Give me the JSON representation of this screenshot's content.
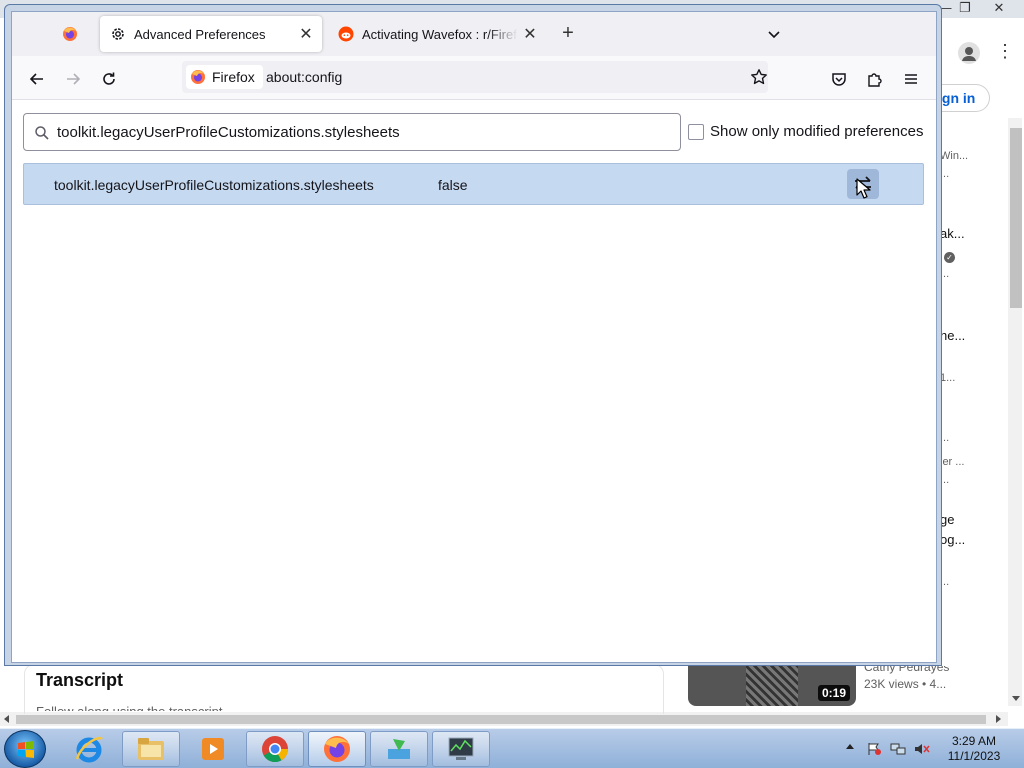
{
  "background_window": {
    "controls": [
      "—",
      "❐",
      "✕"
    ],
    "signin_label": "ign in",
    "fragments": [
      "Win...",
      "...",
      "ak...",
      "...",
      "he...",
      "1...",
      "...",
      "ler ...",
      "...",
      "ge",
      "og...",
      "..."
    ],
    "transcript_title": "Transcript",
    "transcript_sub": "Follow along using the transcript.",
    "video_duration": "0:19",
    "video_author": "Cathy Pedrayes",
    "video_views": "23K views • 4..."
  },
  "tabs": [
    {
      "label": "",
      "icon": "firefox-icon"
    },
    {
      "label": "Advanced Preferences",
      "icon": "gear-icon",
      "active": true
    },
    {
      "label": "Activating Wavefox : r/FirefoxCSS",
      "icon": "reddit-icon"
    }
  ],
  "window_controls": {
    "minimize": "—",
    "maximize": "❐",
    "close": "✕"
  },
  "navbar": {
    "identity_label": "Firefox",
    "url": "about:config"
  },
  "config": {
    "search_value": "toolkit.legacyUserProfileCustomizations.stylesheets",
    "modified_only_label": "Show only modified preferences",
    "modified_only_checked": false,
    "preferences": [
      {
        "name": "toolkit.legacyUserProfileCustomizations.stylesheets",
        "value": "false"
      }
    ]
  },
  "taskbar": {
    "apps": [
      "internet-explorer",
      "file-explorer",
      "media-player",
      "chrome",
      "firefox",
      "installer",
      "task-manager"
    ],
    "clock_time": "3:29 AM",
    "clock_date": "11/1/2023"
  },
  "colors": {
    "row_highlight": "#c5d9f0",
    "toggle_bg": "#9fb8d9",
    "link_blue": "#065fd4"
  }
}
